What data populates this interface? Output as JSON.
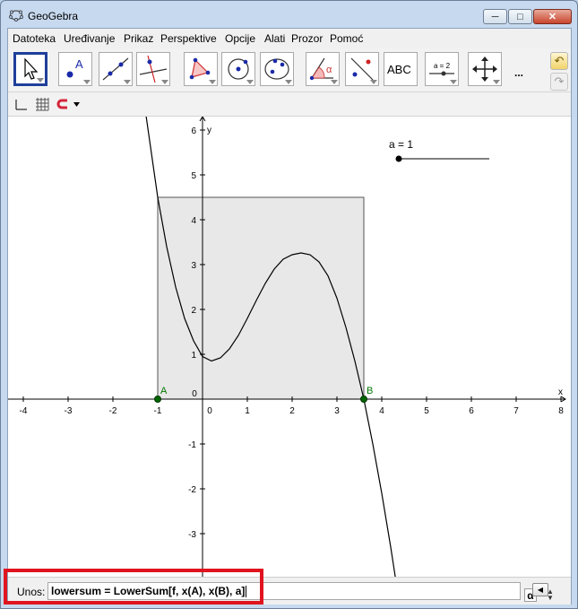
{
  "window": {
    "title": "GeoGebra",
    "minimize_icon": "minimize-icon",
    "maximize_icon": "maximize-icon",
    "close_icon": "close-icon"
  },
  "menu": [
    "Datoteka",
    "Uređivanje",
    "Prikaz",
    "Perspektive",
    "Opcije",
    "Alati",
    "Prozor",
    "Pomoć"
  ],
  "toolbar": {
    "tools": [
      {
        "name": "move-tool",
        "icon": "cursor-arrow-icon",
        "selected": true
      },
      {
        "name": "point-tool",
        "icon": "point-icon",
        "label": "A"
      },
      {
        "name": "line-tool",
        "icon": "line-through-points-icon"
      },
      {
        "name": "perpendicular-line-tool",
        "icon": "perpendicular-line-icon"
      },
      {
        "name": "polygon-tool",
        "icon": "polygon-icon"
      },
      {
        "name": "circle-tool",
        "icon": "circle-center-point-icon"
      },
      {
        "name": "conic-tool",
        "icon": "ellipse-icon"
      },
      {
        "name": "angle-tool",
        "icon": "angle-icon",
        "label": "α"
      },
      {
        "name": "reflect-tool",
        "icon": "reflect-about-line-icon"
      },
      {
        "name": "text-tool",
        "icon": "text-icon",
        "label": "ABC"
      },
      {
        "name": "slider-tool",
        "icon": "slider-icon",
        "label": "a = 2"
      },
      {
        "name": "move-graphics-tool",
        "icon": "move-graphics-icon"
      }
    ],
    "more_label": "...",
    "undo_icon": "undo-icon",
    "redo_icon": "redo-icon"
  },
  "stylebar": {
    "icons": [
      "axes-toggle-icon",
      "grid-toggle-icon",
      "point-capture-icon",
      "dropdown-arrow-icon"
    ]
  },
  "graphics": {
    "x_label": "x",
    "y_label": "y",
    "x_ticks": [
      "-4",
      "-3",
      "-2",
      "-1",
      "0",
      "1",
      "2",
      "3",
      "4",
      "5",
      "6",
      "7",
      "8"
    ],
    "y_ticks": [
      "-3",
      "-2",
      "-1",
      "1",
      "2",
      "3",
      "4",
      "5",
      "6"
    ],
    "origin_label": "0",
    "x_range": [
      -4.4,
      8.2
    ],
    "y_range": [
      -4.1,
      6.3
    ],
    "slider": {
      "label": "a = 1",
      "value": 1
    },
    "points": [
      {
        "label": "A",
        "x": -1,
        "y": 0
      },
      {
        "label": "B",
        "x": 3.6,
        "y": 0
      }
    ],
    "lower_sum_rect": {
      "x0": -1,
      "x1": 3.6,
      "height": 4.5
    },
    "curve_samples": [
      [
        -1.3,
        6.6
      ],
      [
        -1.2,
        5.9
      ],
      [
        -1.0,
        4.5
      ],
      [
        -0.8,
        3.4
      ],
      [
        -0.6,
        2.5
      ],
      [
        -0.4,
        1.8
      ],
      [
        -0.2,
        1.3
      ],
      [
        0.0,
        0.95
      ],
      [
        0.2,
        0.85
      ],
      [
        0.4,
        0.92
      ],
      [
        0.6,
        1.12
      ],
      [
        0.8,
        1.42
      ],
      [
        1.0,
        1.8
      ],
      [
        1.2,
        2.2
      ],
      [
        1.4,
        2.58
      ],
      [
        1.6,
        2.9
      ],
      [
        1.8,
        3.12
      ],
      [
        2.0,
        3.22
      ],
      [
        2.2,
        3.26
      ],
      [
        2.4,
        3.22
      ],
      [
        2.6,
        3.06
      ],
      [
        2.8,
        2.75
      ],
      [
        3.0,
        2.25
      ],
      [
        3.2,
        1.6
      ],
      [
        3.4,
        0.85
      ],
      [
        3.6,
        0.0
      ],
      [
        3.8,
        -1.0
      ],
      [
        4.0,
        -2.1
      ],
      [
        4.2,
        -3.3
      ],
      [
        4.4,
        -4.6
      ]
    ],
    "colors": {
      "axis": "#000000",
      "rect_fill": "#e8e8e8",
      "rect_stroke": "#555555",
      "point": "#006600",
      "point_label": "#007700"
    }
  },
  "input_bar": {
    "label": "Unos:",
    "value": "lowersum = LowerSum[f, x(A), x(B), a]",
    "alpha_button": "α",
    "help_icon": "input-help-icon"
  },
  "annotation_color": "#e0141e"
}
